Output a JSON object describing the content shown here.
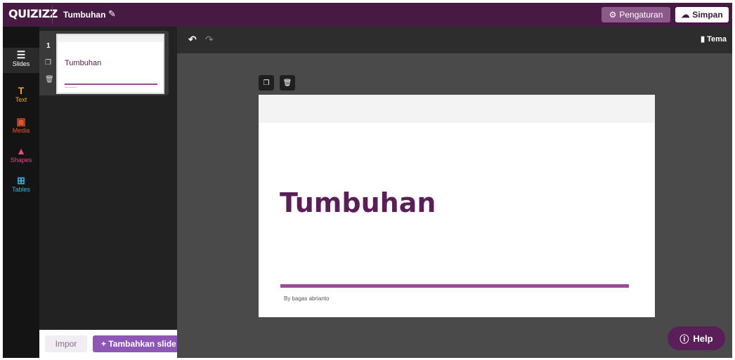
{
  "app": {
    "logo": "QUIZIZZ",
    "doc_title": "Tumbuhan",
    "edit_icon": "pencil-icon"
  },
  "toolbar": {
    "settings_label": "Pengaturan",
    "settings_icon": "gear-icon",
    "save_label": "Simpan",
    "save_icon": "cloud-icon"
  },
  "sidebar": {
    "items": [
      {
        "label": "Slides",
        "icon": "slides-icon",
        "color": "#ffffff"
      },
      {
        "label": "Text",
        "icon": "text-icon",
        "color": "#f5a623"
      },
      {
        "label": "Media",
        "icon": "media-icon",
        "color": "#e4572e"
      },
      {
        "label": "Shapes",
        "icon": "shapes-icon",
        "color": "#e84a8a"
      },
      {
        "label": "Tables",
        "icon": "tables-icon",
        "color": "#39b6e0"
      }
    ]
  },
  "slides_panel": {
    "slides": [
      {
        "number": "1",
        "title": "Tumbuhan"
      }
    ],
    "import_label": "Impor",
    "add_label": "+ Tambahkan slide b"
  },
  "canvas": {
    "theme_label": "Tema",
    "slide": {
      "title": "Tumbuhan",
      "author": "By bagas abrianto"
    }
  },
  "help": {
    "label": "Help"
  },
  "colors": {
    "brand": "#461a42",
    "accent": "#9b4a99",
    "add_button": "#8e57b6"
  }
}
